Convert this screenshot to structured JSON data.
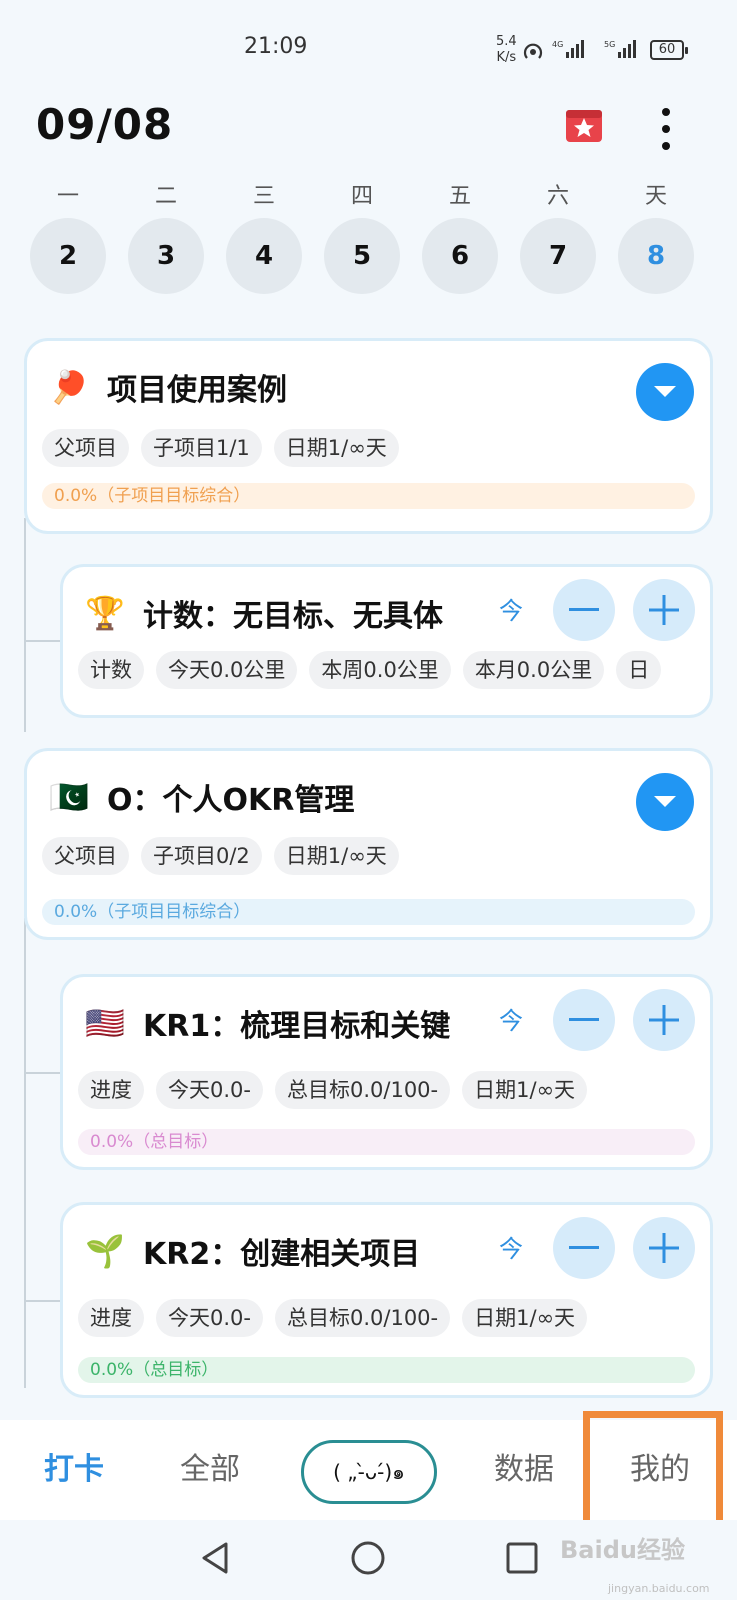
{
  "status_bar": {
    "time": "21:09",
    "net_speed_value": "5.4",
    "net_speed_unit": "K/s",
    "battery": "60"
  },
  "header": {
    "date": "09/08",
    "icons": [
      "gift-icon",
      "more-vertical-icon"
    ]
  },
  "week": [
    {
      "name": "一",
      "date": "2"
    },
    {
      "name": "二",
      "date": "3"
    },
    {
      "name": "三",
      "date": "4"
    },
    {
      "name": "四",
      "date": "5"
    },
    {
      "name": "五",
      "date": "6"
    },
    {
      "name": "六",
      "date": "7"
    },
    {
      "name": "天",
      "date": "8",
      "selected": true
    }
  ],
  "cards": [
    {
      "emoji": "🏓",
      "title": "项目使用案例",
      "tags": [
        "父项目",
        "子项目1/1",
        "日期1/∞天"
      ],
      "progress": "0.0%（子项目目标综合）",
      "accent": "#fff1e2"
    },
    {
      "emoji": "🏆",
      "title": "计数：无目标、无具体",
      "today": "今",
      "tags": [
        "计数",
        "今天0.0公里",
        "本周0.0公里",
        "本月0.0公里",
        "日"
      ]
    },
    {
      "emoji": "🇵🇰",
      "title": "O：个人OKR管理",
      "tags": [
        "父项目",
        "子项目0/2",
        "日期1/∞天"
      ],
      "progress": "0.0%（子项目目标综合）",
      "accent": "#e6f3fb"
    },
    {
      "emoji": "🇺🇸",
      "title": "KR1：梳理目标和关键",
      "today": "今",
      "tags": [
        "进度",
        "今天0.0-",
        "总目标0.0/100-",
        "日期1/∞天"
      ],
      "progress": "0.0%（总目标）",
      "accent": "#f8eef7"
    },
    {
      "emoji": "🌱",
      "title": "KR2：创建相关项目",
      "today": "今",
      "tags": [
        "进度",
        "今天0.0-",
        "总目标0.0/100-",
        "日期1/∞天"
      ],
      "progress": "0.0%（总目标）",
      "accent": "#e3f5ea"
    }
  ],
  "bottom_nav": {
    "checkin": "打卡",
    "all": "全部",
    "center": "( „-̀ᴗ-́)๑",
    "data": "数据",
    "mine": "我的"
  },
  "watermark": {
    "brand": "Baidu经验",
    "url": "jingyan.baidu.com"
  },
  "colors": {
    "primary": "#2196f3",
    "active_text": "#2f8fe0",
    "highlight": "#f08a3a"
  }
}
